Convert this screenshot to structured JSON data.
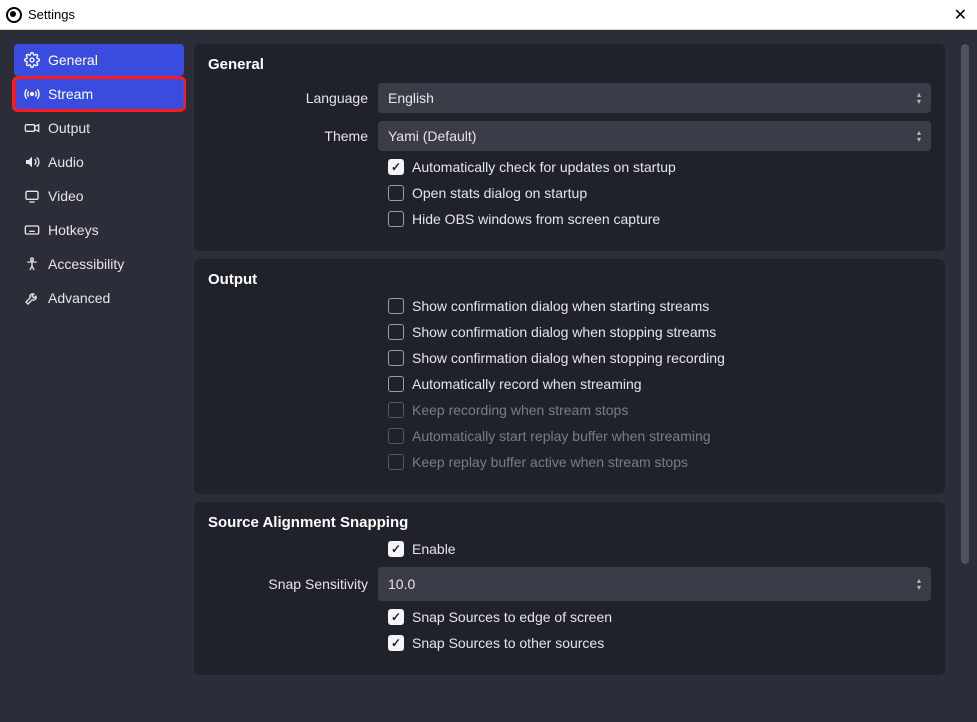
{
  "window": {
    "title": "Settings",
    "close": "✕"
  },
  "sidebar": {
    "items": [
      {
        "icon": "gear",
        "label": "General"
      },
      {
        "icon": "antenna",
        "label": "Stream"
      },
      {
        "icon": "camera",
        "label": "Output"
      },
      {
        "icon": "speaker",
        "label": "Audio"
      },
      {
        "icon": "monitor",
        "label": "Video"
      },
      {
        "icon": "keyboard",
        "label": "Hotkeys"
      },
      {
        "icon": "person",
        "label": "Accessibility"
      },
      {
        "icon": "tools",
        "label": "Advanced"
      }
    ]
  },
  "general": {
    "title": "General",
    "language_label": "Language",
    "language_value": "English",
    "theme_label": "Theme",
    "theme_value": "Yami (Default)",
    "chk_updates": "Automatically check for updates on startup",
    "chk_stats": "Open stats dialog on startup",
    "chk_hideobs": "Hide OBS windows from screen capture"
  },
  "output": {
    "title": "Output",
    "chk_start": "Show confirmation dialog when starting streams",
    "chk_stop": "Show confirmation dialog when stopping streams",
    "chk_stoprec": "Show confirmation dialog when stopping recording",
    "chk_autorec": "Automatically record when streaming",
    "chk_keeprec": "Keep recording when stream stops",
    "chk_autorep": "Automatically start replay buffer when streaming",
    "chk_keeprep": "Keep replay buffer active when stream stops"
  },
  "snapping": {
    "title": "Source Alignment Snapping",
    "chk_enable": "Enable",
    "sens_label": "Snap Sensitivity",
    "sens_value": "10.0",
    "chk_edge": "Snap Sources to edge of screen",
    "chk_other": "Snap Sources to other sources"
  }
}
